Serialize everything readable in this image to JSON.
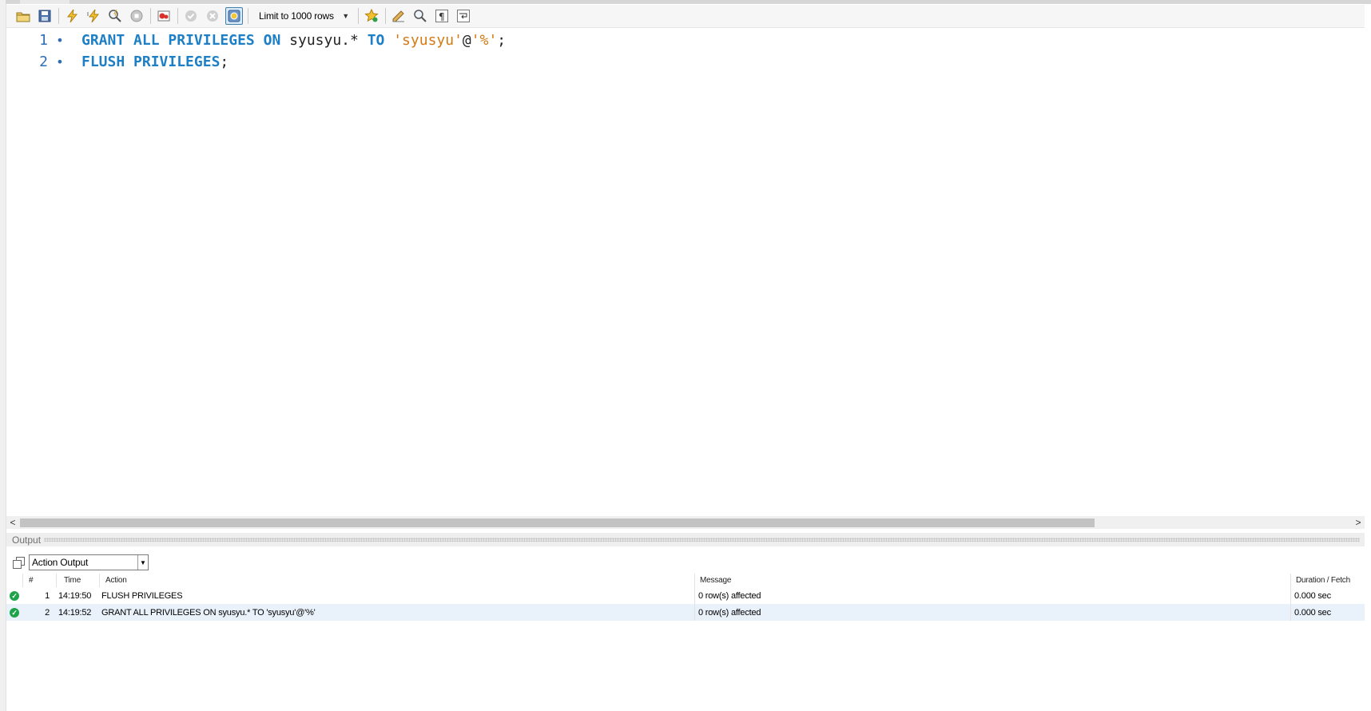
{
  "toolbar": {
    "limit_label": "Limit to 1000 rows",
    "icons": [
      "open-folder-icon",
      "save-icon",
      "execute-icon",
      "execute-current-icon",
      "explain-icon",
      "stop-icon",
      "toggle-error-icon",
      "commit-icon",
      "rollback-icon",
      "autocommit-icon",
      "add-snippet-icon",
      "beautify-icon",
      "find-icon",
      "invisible-chars-icon",
      "word-wrap-icon"
    ]
  },
  "editor": {
    "lines": [
      {
        "number": "1",
        "marker": "•",
        "tokens": [
          {
            "t": "GRANT",
            "k": "kw"
          },
          {
            "t": " ",
            "k": "id"
          },
          {
            "t": "ALL",
            "k": "kw"
          },
          {
            "t": " ",
            "k": "id"
          },
          {
            "t": "PRIVILEGES",
            "k": "kw"
          },
          {
            "t": " ",
            "k": "id"
          },
          {
            "t": "ON",
            "k": "kw"
          },
          {
            "t": " ",
            "k": "id"
          },
          {
            "t": "syusyu.*",
            "k": "id"
          },
          {
            "t": " ",
            "k": "id"
          },
          {
            "t": "TO",
            "k": "kw"
          },
          {
            "t": " ",
            "k": "id"
          },
          {
            "t": "'syusyu'",
            "k": "str"
          },
          {
            "t": "@",
            "k": "pun"
          },
          {
            "t": "'%'",
            "k": "str"
          },
          {
            "t": ";",
            "k": "pun"
          }
        ]
      },
      {
        "number": "2",
        "marker": "•",
        "tokens": [
          {
            "t": "FLUSH",
            "k": "kw"
          },
          {
            "t": " ",
            "k": "id"
          },
          {
            "t": "PRIVILEGES",
            "k": "kw"
          },
          {
            "t": ";",
            "k": "pun"
          }
        ]
      }
    ]
  },
  "output": {
    "title": "Output",
    "select_value": "Action Output",
    "columns": {
      "num": "#",
      "time": "Time",
      "action": "Action",
      "message": "Message",
      "duration": "Duration / Fetch"
    },
    "rows": [
      {
        "num": "1",
        "time": "14:19:50",
        "action": "FLUSH PRIVILEGES",
        "message": "0 row(s) affected",
        "duration": "0.000 sec"
      },
      {
        "num": "2",
        "time": "14:19:52",
        "action": "GRANT ALL PRIVILEGES ON syusyu.* TO 'syusyu'@'%'",
        "message": "0 row(s) affected",
        "duration": "0.000 sec"
      }
    ]
  },
  "colors": {
    "keyword": "#1d7fc6",
    "string": "#d57a12",
    "line_number": "#2f6db4",
    "ok": "#1fa34a",
    "row_highlight": "#e9f1fb"
  }
}
